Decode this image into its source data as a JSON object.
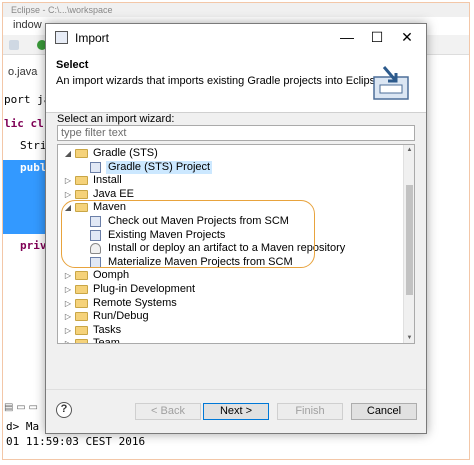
{
  "ide": {
    "titlebar_text": "Eclipse - C:\\...\\workspace",
    "menu_text": "indow",
    "editor_tab": "o.java",
    "code_lines": [
      "port ja",
      "lic cl",
      "Strin",
      "publi",
      "priva"
    ],
    "console_lines": [
      "d> Ma",
      "01 11:59:03 CEST 2016"
    ]
  },
  "dialog": {
    "title": "Import",
    "minimize_label": "—",
    "maximize_label": "☐",
    "close_label": "✕",
    "header_title": "Select",
    "header_desc": "An import wizards that imports existing Gradle projects into Eclipse.",
    "select_label": "Select an import wizard:",
    "filter_placeholder": "type filter text",
    "tree": [
      {
        "label": "Gradle (STS)",
        "level": 0,
        "type": "folder",
        "expanded": true
      },
      {
        "label": "Gradle (STS) Project",
        "level": 1,
        "type": "item",
        "selected": true
      },
      {
        "label": "Install",
        "level": 0,
        "type": "folder",
        "expanded": false
      },
      {
        "label": "Java EE",
        "level": 0,
        "type": "folder",
        "expanded": false
      },
      {
        "label": "Maven",
        "level": 0,
        "type": "folder",
        "expanded": true
      },
      {
        "label": "Check out Maven Projects from SCM",
        "level": 1,
        "type": "item"
      },
      {
        "label": "Existing Maven Projects",
        "level": 1,
        "type": "item"
      },
      {
        "label": "Install or deploy an artifact to a Maven repository",
        "level": 1,
        "type": "person"
      },
      {
        "label": "Materialize Maven Projects from SCM",
        "level": 1,
        "type": "item"
      },
      {
        "label": "Oomph",
        "level": 0,
        "type": "folder",
        "expanded": false
      },
      {
        "label": "Plug-in Development",
        "level": 0,
        "type": "folder",
        "expanded": false
      },
      {
        "label": "Remote Systems",
        "level": 0,
        "type": "folder",
        "expanded": false
      },
      {
        "label": "Run/Debug",
        "level": 0,
        "type": "folder",
        "expanded": false
      },
      {
        "label": "Tasks",
        "level": 0,
        "type": "folder",
        "expanded": false
      },
      {
        "label": "Team",
        "level": 0,
        "type": "folder",
        "expanded": false
      }
    ],
    "buttons": {
      "help": "?",
      "back": "< Back",
      "next": "Next >",
      "finish": "Finish",
      "cancel": "Cancel"
    }
  },
  "colors": {
    "highlight": "#e8a33d",
    "selection": "#cce8ff",
    "folder": "#f5d27a"
  }
}
